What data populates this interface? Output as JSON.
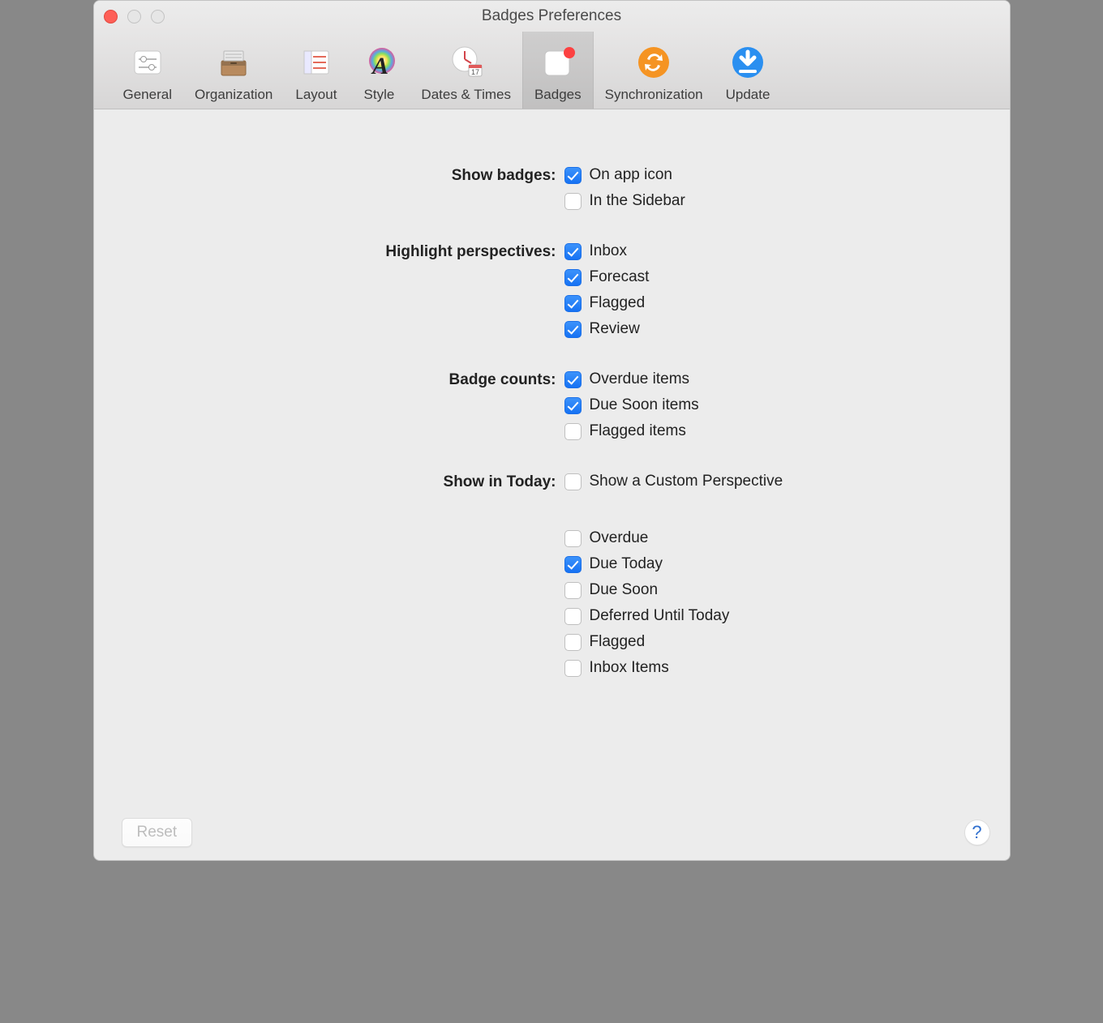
{
  "window": {
    "title": "Badges Preferences"
  },
  "toolbar": {
    "items": [
      {
        "id": "general",
        "label": "General"
      },
      {
        "id": "organization",
        "label": "Organization"
      },
      {
        "id": "layout",
        "label": "Layout"
      },
      {
        "id": "style",
        "label": "Style"
      },
      {
        "id": "dates-times",
        "label": "Dates & Times"
      },
      {
        "id": "badges",
        "label": "Badges",
        "selected": true
      },
      {
        "id": "synchronization",
        "label": "Synchronization"
      },
      {
        "id": "update",
        "label": "Update"
      }
    ]
  },
  "sections": {
    "show_badges": {
      "label": "Show badges:",
      "options": [
        {
          "label": "On app icon",
          "checked": true
        },
        {
          "label": "In the Sidebar",
          "checked": false
        }
      ]
    },
    "highlight_perspectives": {
      "label": "Highlight perspectives:",
      "options": [
        {
          "label": "Inbox",
          "checked": true
        },
        {
          "label": "Forecast",
          "checked": true
        },
        {
          "label": "Flagged",
          "checked": true
        },
        {
          "label": "Review",
          "checked": true
        }
      ]
    },
    "badge_counts": {
      "label": "Badge counts:",
      "options": [
        {
          "label": "Overdue items",
          "checked": true
        },
        {
          "label": "Due Soon items",
          "checked": true
        },
        {
          "label": "Flagged items",
          "checked": false
        }
      ]
    },
    "show_in_today": {
      "label": "Show in Today:",
      "top_options": [
        {
          "label": "Show a Custom Perspective",
          "checked": false
        }
      ],
      "options": [
        {
          "label": "Overdue",
          "checked": false
        },
        {
          "label": "Due Today",
          "checked": true
        },
        {
          "label": "Due Soon",
          "checked": false
        },
        {
          "label": "Deferred Until Today",
          "checked": false
        },
        {
          "label": "Flagged",
          "checked": false
        },
        {
          "label": "Inbox Items",
          "checked": false
        }
      ]
    }
  },
  "footer": {
    "reset_label": "Reset",
    "help_label": "?"
  }
}
